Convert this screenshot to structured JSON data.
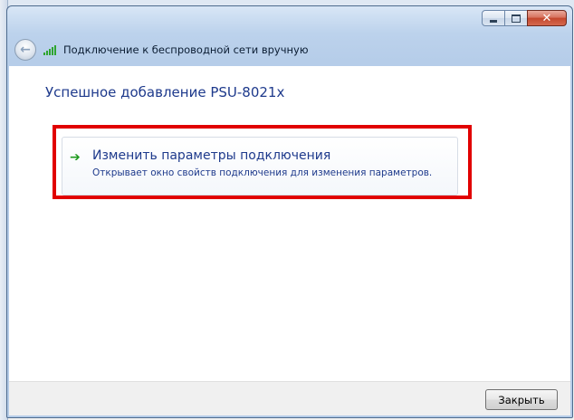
{
  "window": {
    "title": "Подключение к беспроводной сети вручную",
    "close_glyph": "✕"
  },
  "header": {
    "back_glyph": "←",
    "back_icon": "back-arrow-icon",
    "network_icon": "wireless-signal-icon"
  },
  "main": {
    "heading": "Успешное добавление PSU-8021x",
    "command_link": {
      "icon": "green-arrow-icon",
      "arrow_glyph": "➔",
      "title": "Изменить параметры подключения",
      "description": "Открывает окно свойств подключения для изменения параметров."
    },
    "highlight_color": "#e10000"
  },
  "footer": {
    "close_label": "Закрыть"
  }
}
